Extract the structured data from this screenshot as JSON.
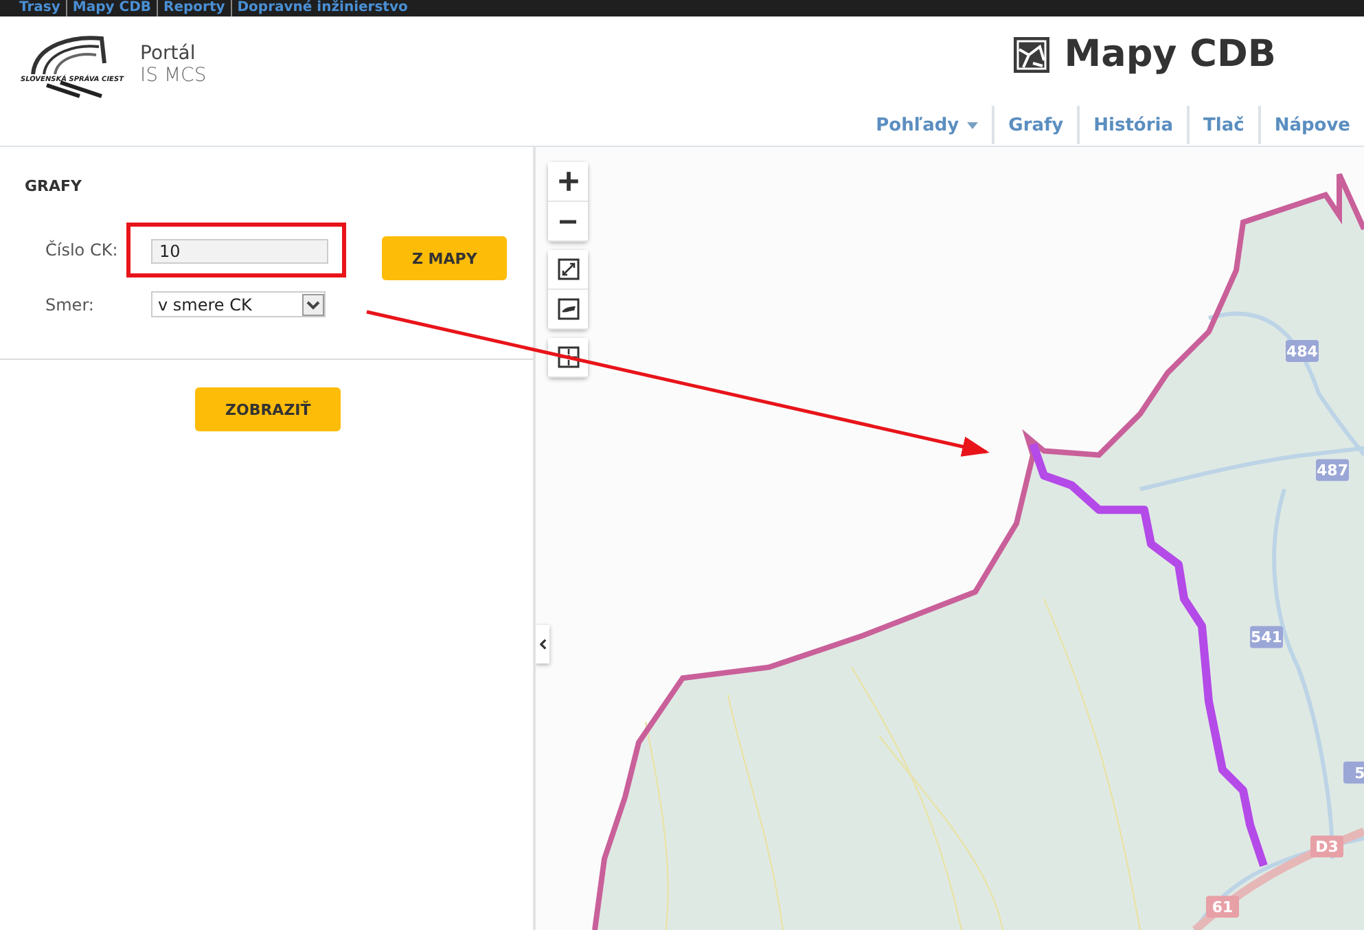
{
  "top_nav": {
    "items": [
      "Trasy",
      "Mapy CDB",
      "Reporty",
      "Dopravné inžinierstvo"
    ]
  },
  "logo": {
    "org_text": "SLOVENSKÁ SPRÁVA CIEST",
    "title": "Portál",
    "subtitle": "IS MCS"
  },
  "app_title": "Mapy CDB",
  "menu": [
    {
      "label": "Pohľady",
      "kind": "dropdown"
    },
    {
      "label": "Grafy",
      "kind": "link"
    },
    {
      "label": "História",
      "kind": "link"
    },
    {
      "label": "Tlač",
      "kind": "link"
    },
    {
      "label": "Nápove",
      "kind": "link"
    }
  ],
  "panel": {
    "title": "GRAFY",
    "fields": [
      {
        "label": "Číslo CK:",
        "kind": "input",
        "value": "10",
        "highlighted": true
      },
      {
        "label": "Smer:",
        "kind": "select",
        "value": "v smere CK",
        "highlighted": false
      }
    ],
    "pick_button": "Z MAPY",
    "show_button": "ZOBRAZIŤ"
  },
  "map": {
    "road_labels": [
      {
        "text": "484",
        "kind": "road"
      },
      {
        "text": "487",
        "kind": "road"
      },
      {
        "text": "541",
        "kind": "road"
      },
      {
        "text": "5",
        "kind": "road"
      },
      {
        "text": "D3",
        "kind": "highway"
      },
      {
        "text": "61",
        "kind": "highway"
      }
    ]
  }
}
